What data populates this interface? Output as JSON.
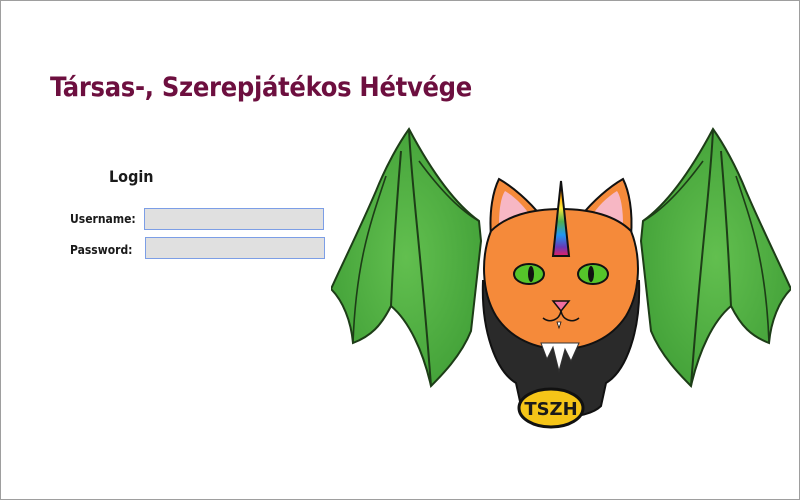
{
  "site": {
    "title": "Társas-, Szerepjátékos Hétvége"
  },
  "login": {
    "heading": "Login",
    "username_label": "Username:",
    "username_value": "",
    "password_label": "Password:",
    "password_value": ""
  },
  "logo": {
    "badge_text": "TSZH",
    "colors": {
      "wing": "#4caf43",
      "fur": "#f58a3a",
      "horn": "rainbow",
      "eyes": "#55c52a",
      "badge": "#f5c518"
    }
  }
}
